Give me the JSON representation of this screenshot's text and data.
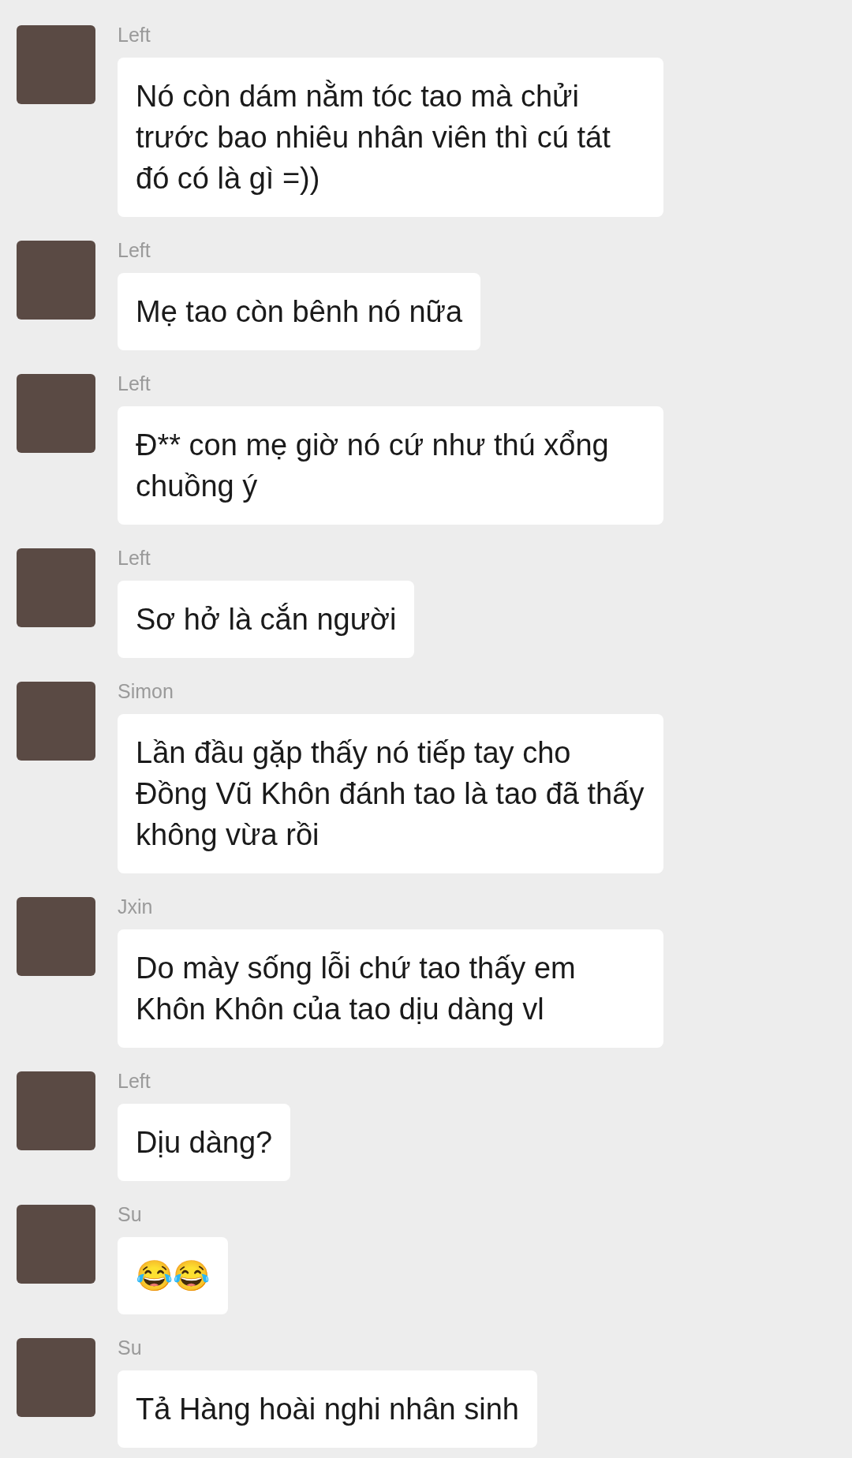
{
  "messages": [
    {
      "sender": "Left",
      "text": "Nó còn dám nằm tóc tao mà chửi trước bao nhiêu nhân viên thì cú tát đó có là gì =))"
    },
    {
      "sender": "Left",
      "text": "Mẹ tao còn bênh nó nữa"
    },
    {
      "sender": "Left",
      "text": "Đ** con mẹ giờ nó cứ như thú xổng chuồng ý"
    },
    {
      "sender": "Left",
      "text": "Sơ hở là cắn người"
    },
    {
      "sender": "Simon",
      "text": "Lần đầu gặp thấy nó tiếp tay cho Đồng Vũ Khôn đánh tao là tao đã thấy không vừa rồi"
    },
    {
      "sender": "Jxin",
      "text": "Do mày sống lỗi chứ tao thấy em Khôn Khôn của tao dịu dàng vl"
    },
    {
      "sender": "Left",
      "text": "Dịu dàng?"
    },
    {
      "sender": "Su",
      "text": "😂😂"
    },
    {
      "sender": "Su",
      "text": "Tả Hàng hoài nghi nhân sinh"
    }
  ]
}
